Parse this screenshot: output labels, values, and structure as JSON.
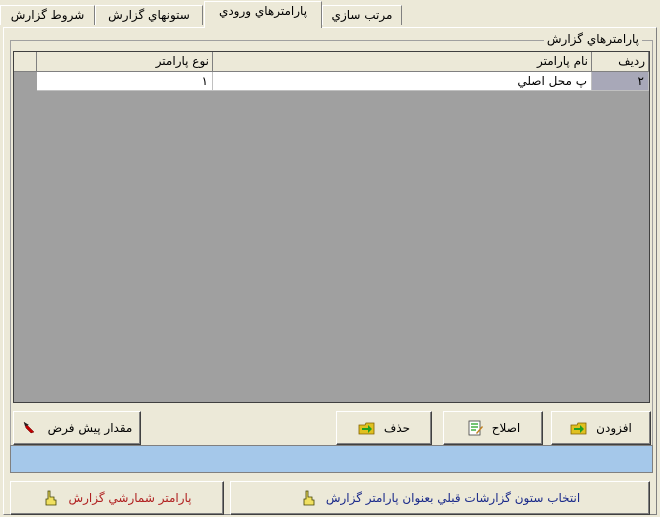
{
  "tabs": [
    {
      "label": "مرتب سازي"
    },
    {
      "label": "پارامترهاي ورودي"
    },
    {
      "label": "ستونهاي گزارش"
    },
    {
      "label": "شروط گزارش"
    }
  ],
  "group": {
    "title": "پارامترهاي گزارش"
  },
  "grid": {
    "columns": [
      "رديف",
      "نام پارامتر",
      "نوع پارامتر"
    ],
    "rows": [
      {
        "index": "۲",
        "name": "پ محل اصلي",
        "type": "۱"
      }
    ]
  },
  "buttons": {
    "add": "افزودن",
    "edit": "اصلاح",
    "delete": "حذف",
    "default_value": "مقدار پيش فرض",
    "select_prev_column": "انتخاب ستون گزارشات قبلي بعنوان پارامتر گزارش",
    "counter_param": "پارامتر شمارشي گزارش"
  },
  "colors": {
    "status_bar": "#a5c8ea",
    "selected_row_indicator": "#a8a8b8",
    "red_text": "#b02020",
    "blue_text": "#1a2a8a"
  }
}
